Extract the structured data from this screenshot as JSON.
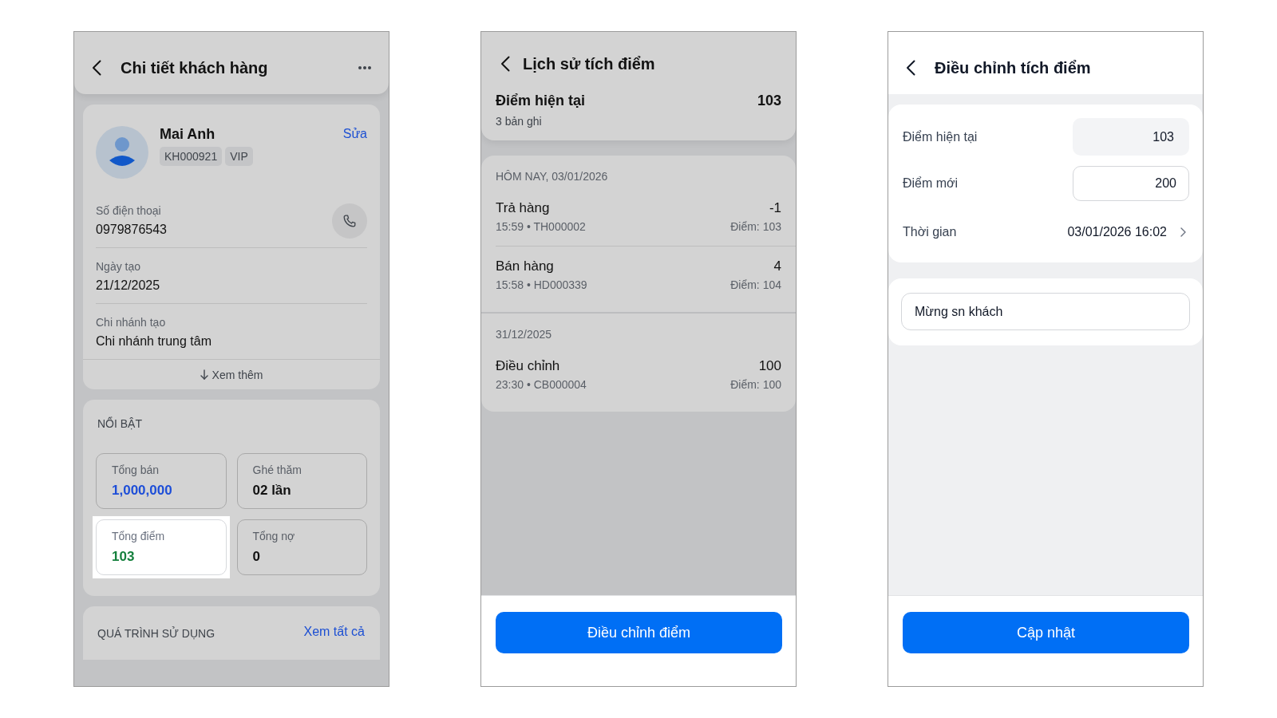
{
  "screens": [
    {
      "kind": "customer_detail",
      "dimmed": true,
      "title": "Chi tiết khách hàng",
      "profile": {
        "name": "Mai Anh",
        "tags": [
          "KH000921",
          "VIP"
        ],
        "edit_link": "Sửa"
      },
      "fields": [
        {
          "kind": "phone",
          "label": "Số điện thoại",
          "value": "0979876543"
        },
        {
          "kind": "text",
          "label": "Ngày tạo",
          "value": "21/12/2025"
        },
        {
          "kind": "text",
          "label": "Chi nhánh tạo",
          "value": "Chi nhánh trung tâm"
        }
      ],
      "more_link": "Xem thêm",
      "highlights": {
        "title": "NỔI BẬT",
        "stats": [
          {
            "label": "Tổng bán",
            "value": "1,000,000",
            "color": "#1d4ed8",
            "highlighted": false
          },
          {
            "label": "Ghé thăm",
            "value": "02 lần",
            "color": "#111111",
            "highlighted": false
          },
          {
            "label": "Tổng điểm",
            "value": "103",
            "color": "#15803d",
            "highlighted": true
          },
          {
            "label": "Tổng nợ",
            "value": "0",
            "color": "#111111",
            "highlighted": false
          }
        ]
      },
      "usage": {
        "title": "QUÁ TRÌNH SỬ DỤNG",
        "link": "Xem tất cả"
      }
    },
    {
      "kind": "points_history",
      "dimmed": true,
      "title": "Lịch sử tích điểm",
      "summary": {
        "label": "Điểm hiện tại",
        "value": "103",
        "count": "3 bản ghi"
      },
      "groups": [
        {
          "date": "HÔM NAY, 03/01/2026",
          "entries": [
            {
              "title": "Trả hàng",
              "meta": "15:59 • TH000002",
              "change": "-1",
              "balance": "Điểm: 103"
            },
            {
              "title": "Bán hàng",
              "meta": "15:58 • HD000339",
              "change": "4",
              "balance": "Điểm: 104"
            }
          ]
        },
        {
          "date": "31/12/2025",
          "entries": [
            {
              "title": "Điều chỉnh",
              "meta": "23:30 • CB000004",
              "change": "100",
              "balance": "Điểm: 100"
            }
          ]
        }
      ],
      "action": "Điều chỉnh điểm"
    },
    {
      "kind": "adjust_points",
      "dimmed": false,
      "title": "Điều chỉnh tích điểm",
      "fields": [
        {
          "kind": "readonly",
          "label": "Điểm hiện tại",
          "value": "103"
        },
        {
          "kind": "input",
          "label": "Điểm mới",
          "value": "200"
        },
        {
          "kind": "picker",
          "label": "Thời gian",
          "value": "03/01/2026 16:02"
        }
      ],
      "note": {
        "value": "Mừng sn khách"
      },
      "action": "Cập nhật"
    }
  ]
}
